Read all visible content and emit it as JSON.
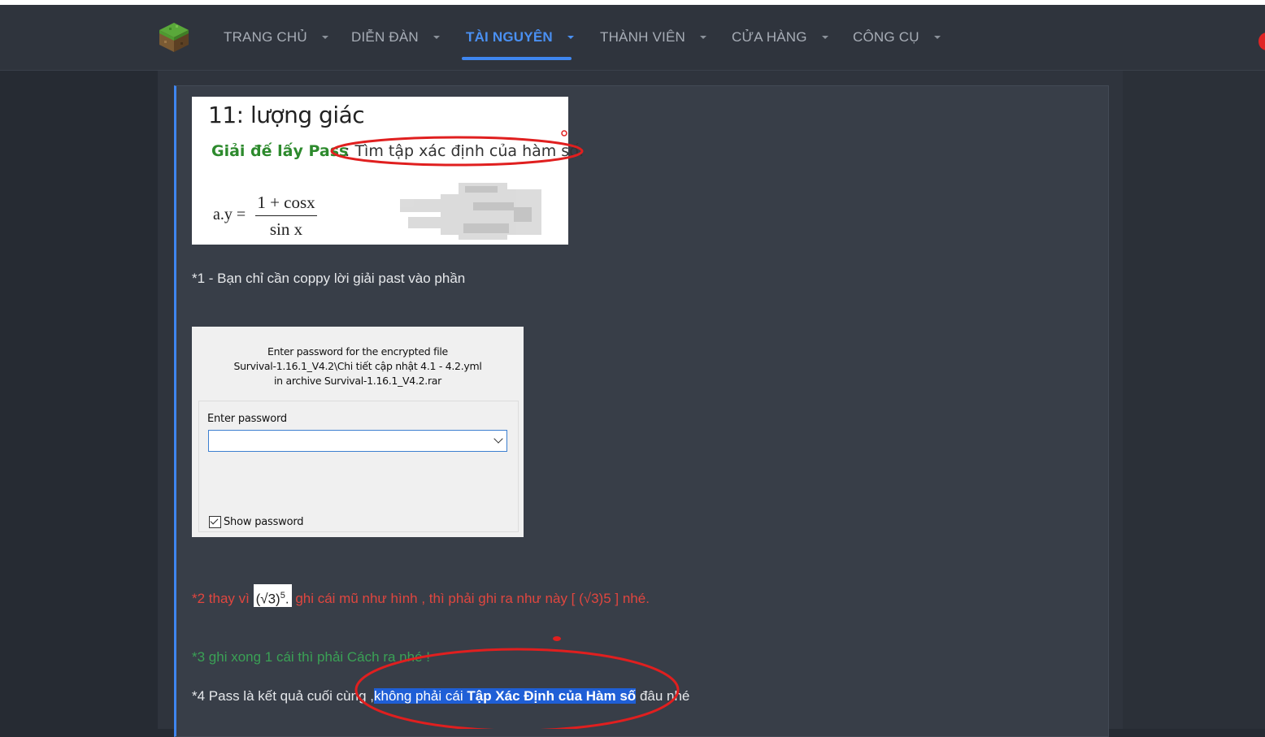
{
  "nav": {
    "items": [
      {
        "label": "TRANG CHỦ"
      },
      {
        "label": "DIỄN ĐÀN"
      },
      {
        "label": "TÀI NGUYÊN"
      },
      {
        "label": "THÀNH VIÊN"
      },
      {
        "label": "CỬA HÀNG"
      },
      {
        "label": "CÔNG CỤ"
      }
    ],
    "active_index": 2,
    "accent_color": "#3f86f0"
  },
  "post": {
    "image1": {
      "heading": "11: lượng giác",
      "green_text": "Giải đế lấy Pass",
      "question": ": Tìm tập xác định của hàm số:",
      "formula_lhs": "a.y =",
      "formula_num": "1 + cosx",
      "formula_den": "sin x"
    },
    "line1": "*1 - Bạn chỉ cần coppy lời giải past vào phần",
    "dialog": {
      "msg_line1": "Enter password for the encrypted file",
      "msg_line2": "Survival-1.16.1_V4.2\\Chi tiết cập nhật 4.1 - 4.2.yml",
      "msg_line3": "in archive Survival-1.16.1_V4.2.rar",
      "enter_password_label": "Enter password",
      "password_value": "",
      "show_password_label": "Show password",
      "show_password_checked": true
    },
    "line2_prefix": "*2 thay vì",
    "line2_sqrt": "(√3)",
    "line2_sup": "5",
    "line2_dot": ".",
    "line2_suffix": "ghi cái mũ như hình , thì phải ghi ra như này [ (√3)5 ] nhé.",
    "line3": "*3 ghi xong 1 cái thì phải Cách ra nhé !",
    "line4_prefix": "*4 Pass là kết quả cuối cùng ,",
    "line4_hl_normal": "không phải cái",
    "line4_hl_bold": "Tập Xác Định của Hàm số",
    "line4_suffix": "đâu nhé",
    "colors": {
      "red_text": "#e0463f",
      "green_text": "#3aa155",
      "highlight": "#1f5fd6",
      "annotation": "#e01f1f"
    }
  }
}
